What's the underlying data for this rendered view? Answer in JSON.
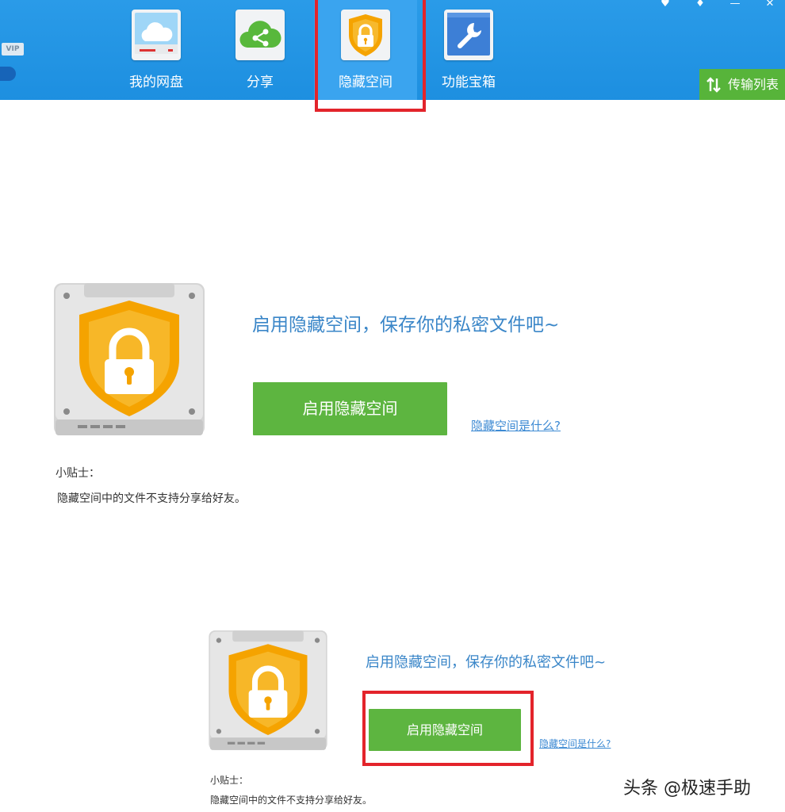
{
  "window_controls": [
    "♥",
    "♦",
    "—",
    "✕"
  ],
  "vip_badge": "VIP",
  "nav": {
    "items": [
      {
        "label": "我的网盘",
        "icon": "cloud-icon"
      },
      {
        "label": "分享",
        "icon": "share-icon"
      },
      {
        "label": "隐藏空间",
        "icon": "shield-lock-icon",
        "active": true
      },
      {
        "label": "功能宝箱",
        "icon": "wrench-icon"
      }
    ],
    "transfer_list": "传输列表"
  },
  "panel_large": {
    "headline": "启用隐藏空间，保存你的私密文件吧~",
    "enable_button": "启用隐藏空间",
    "what_link": "隐藏空间是什么?",
    "tip_title": "小贴士：",
    "tip_text": "隐藏空间中的文件不支持分享给好友。"
  },
  "panel_small": {
    "headline": "启用隐藏空间，保存你的私密文件吧~",
    "enable_button": "启用隐藏空间",
    "what_link": "隐藏空间是什么?",
    "tip_title": "小贴士：",
    "tip_text": "隐藏空间中的文件不支持分享给好友。"
  },
  "watermark": "头条 @极速手助",
  "colors": {
    "topbar": "#1d8fe0",
    "active_tab": "#3aa4ef",
    "highlight": "#e3242b",
    "button_green": "#5db540",
    "headline_blue": "#3a86c8",
    "shield_orange": "#f5a300"
  }
}
